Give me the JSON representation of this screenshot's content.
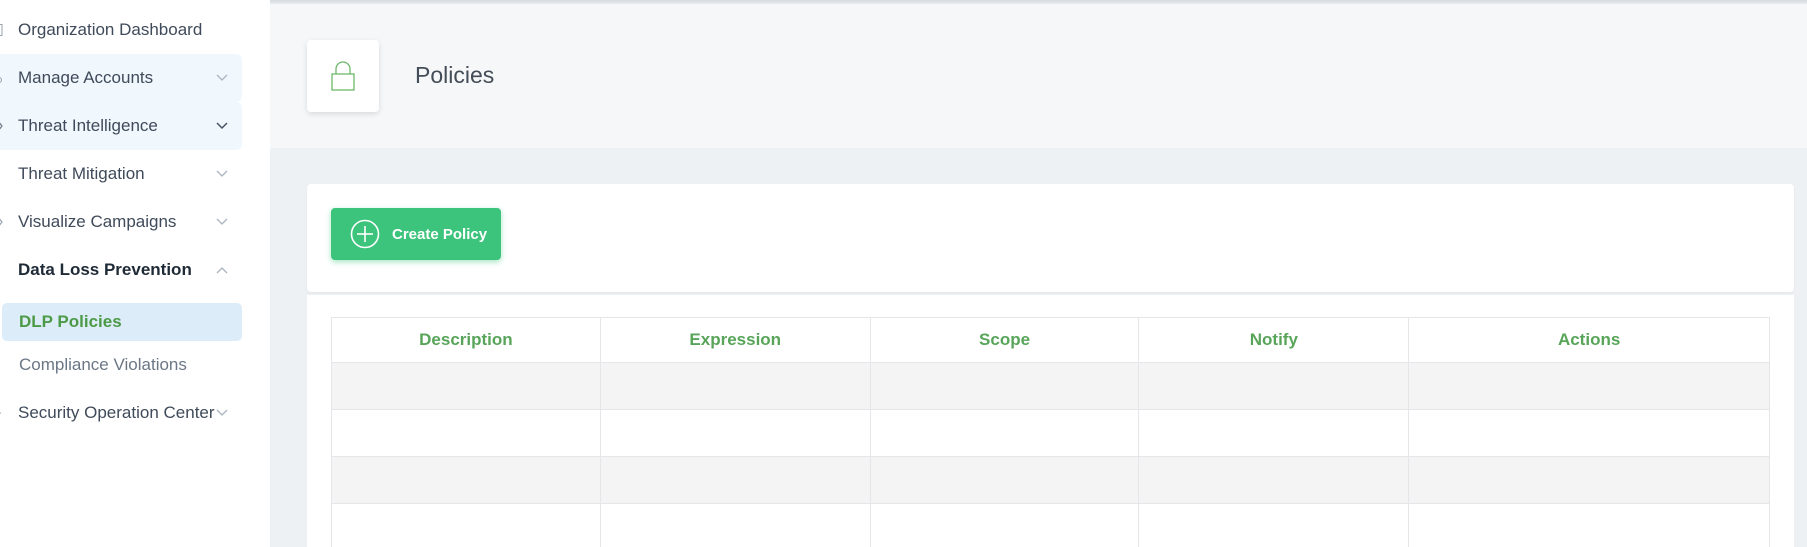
{
  "sidebar": {
    "items": [
      {
        "label": "Organization Dashboard"
      },
      {
        "label": "Manage Accounts"
      },
      {
        "label": "Threat Intelligence"
      },
      {
        "label": "Threat Mitigation"
      },
      {
        "label": "Visualize Campaigns"
      },
      {
        "label": "Data Loss Prevention"
      },
      {
        "label": "Security Operation Center"
      }
    ],
    "subitems": [
      {
        "label": "DLP Policies",
        "active": true
      },
      {
        "label": "Compliance Violations",
        "active": false
      }
    ]
  },
  "header": {
    "title": "Policies",
    "icon": "lock-icon"
  },
  "toolbar": {
    "create_label": "Create Policy",
    "create_icon": "plus-circle-icon"
  },
  "table": {
    "columns": [
      "Description",
      "Expression",
      "Scope",
      "Notify",
      "Actions"
    ]
  },
  "colors": {
    "accent_green": "#3cc47c",
    "header_green": "#58a55a",
    "active_bg": "#dcedf9"
  }
}
